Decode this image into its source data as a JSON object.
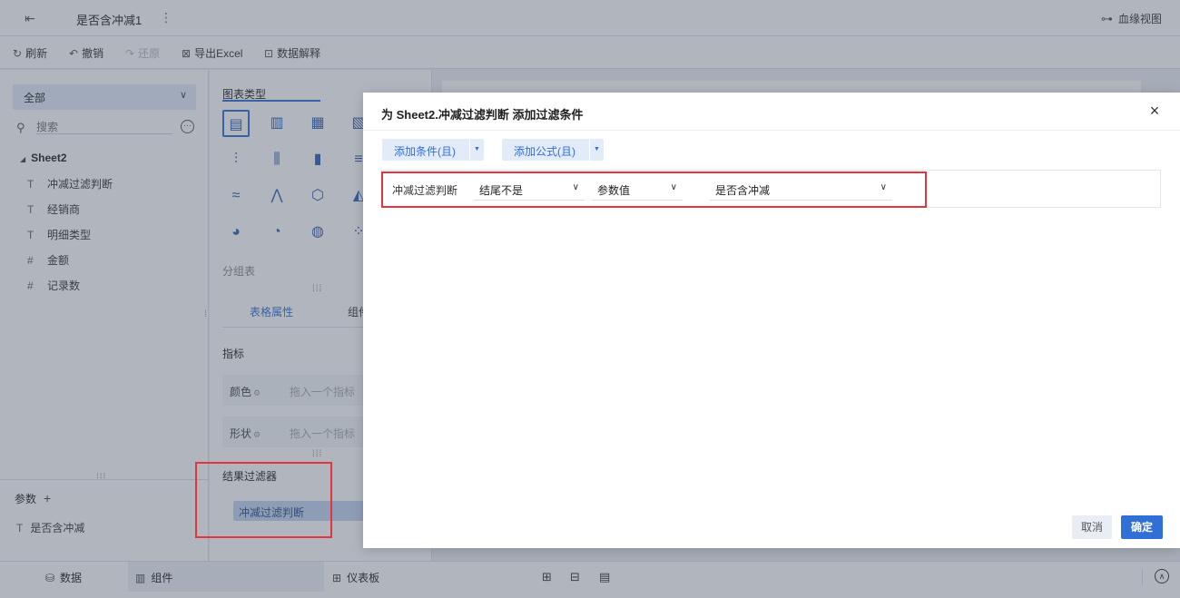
{
  "topbar": {
    "title": "是否含冲减1",
    "more": "⋮",
    "lineage_label": "血缘视图"
  },
  "toolbar": {
    "refresh": "刷新",
    "undo": "撤销",
    "redo": "还原",
    "export_excel": "导出Excel",
    "data_explain": "数据解释"
  },
  "left_panel": {
    "dataset_select": "全部",
    "search_placeholder": "搜索",
    "tree_root": "Sheet2",
    "fields": [
      {
        "type": "T",
        "label": "冲减过滤判断"
      },
      {
        "type": "T",
        "label": "经销商"
      },
      {
        "type": "T",
        "label": "明细类型"
      },
      {
        "type": "#",
        "label": "金额"
      },
      {
        "type": "#",
        "label": "记录数"
      }
    ],
    "params_label": "参数",
    "param_item": "是否含冲减"
  },
  "mid_panel": {
    "chart_type_label": "图表类型",
    "group_table_label": "分组表",
    "tab_table_props": "表格属性",
    "tab_component": "组件",
    "metric_label": "指标",
    "color_label": "颜色",
    "color_placeholder": "拖入一个指标",
    "shape_label": "形状",
    "shape_placeholder": "拖入一个指标",
    "result_filter_label": "结果过滤器",
    "result_filter_chip": "冲减过滤判断"
  },
  "bottom_bar": {
    "tab_data": "数据",
    "tab_component": "组件",
    "tab_dashboard": "仪表板"
  },
  "modal": {
    "title": "为 Sheet2.冲减过滤判断 添加过滤条件",
    "add_condition": "添加条件(且)",
    "add_formula": "添加公式(且)",
    "condition": {
      "field": "冲减过滤判断",
      "operator": "结尾不是",
      "value_type": "参数值",
      "value": "是否含冲减"
    },
    "cancel": "取消",
    "ok": "确定"
  },
  "colors": {
    "accent": "#2f6fd6",
    "highlight_border": "#e5343e",
    "chip_bg": "#c3d4f1"
  }
}
